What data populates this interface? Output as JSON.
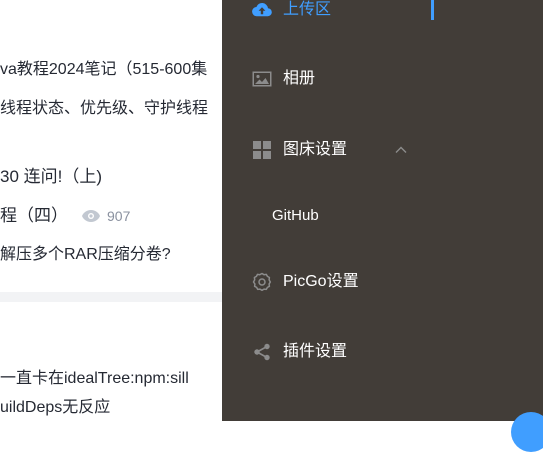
{
  "background_page": {
    "lines": [
      "va教程2024笔记（515-600集",
      "线程状态、优先级、守护线程",
      "30 连问!（上)",
      "程（四）",
      "解压多个RAR压缩分卷?",
      "一直卡在idealTree:npm:sill",
      "uildDeps无反应"
    ],
    "view_count": "907"
  },
  "sidebar": {
    "items": [
      {
        "label": "上传区",
        "icon": "cloud-upload-icon",
        "active": true
      },
      {
        "label": "相册",
        "icon": "image-icon",
        "active": false
      },
      {
        "label": "图床设置",
        "icon": "grid-icon",
        "active": false,
        "expanded": true
      },
      {
        "label": "GitHub",
        "icon": "",
        "active": false
      },
      {
        "label": "PicGo设置",
        "icon": "gear-icon",
        "active": false
      },
      {
        "label": "插件设置",
        "icon": "share-icon",
        "active": false
      }
    ]
  },
  "colors": {
    "sidebar_bg": "#423d38",
    "accent": "#409eff",
    "icon_gray": "#8c8c8c"
  }
}
